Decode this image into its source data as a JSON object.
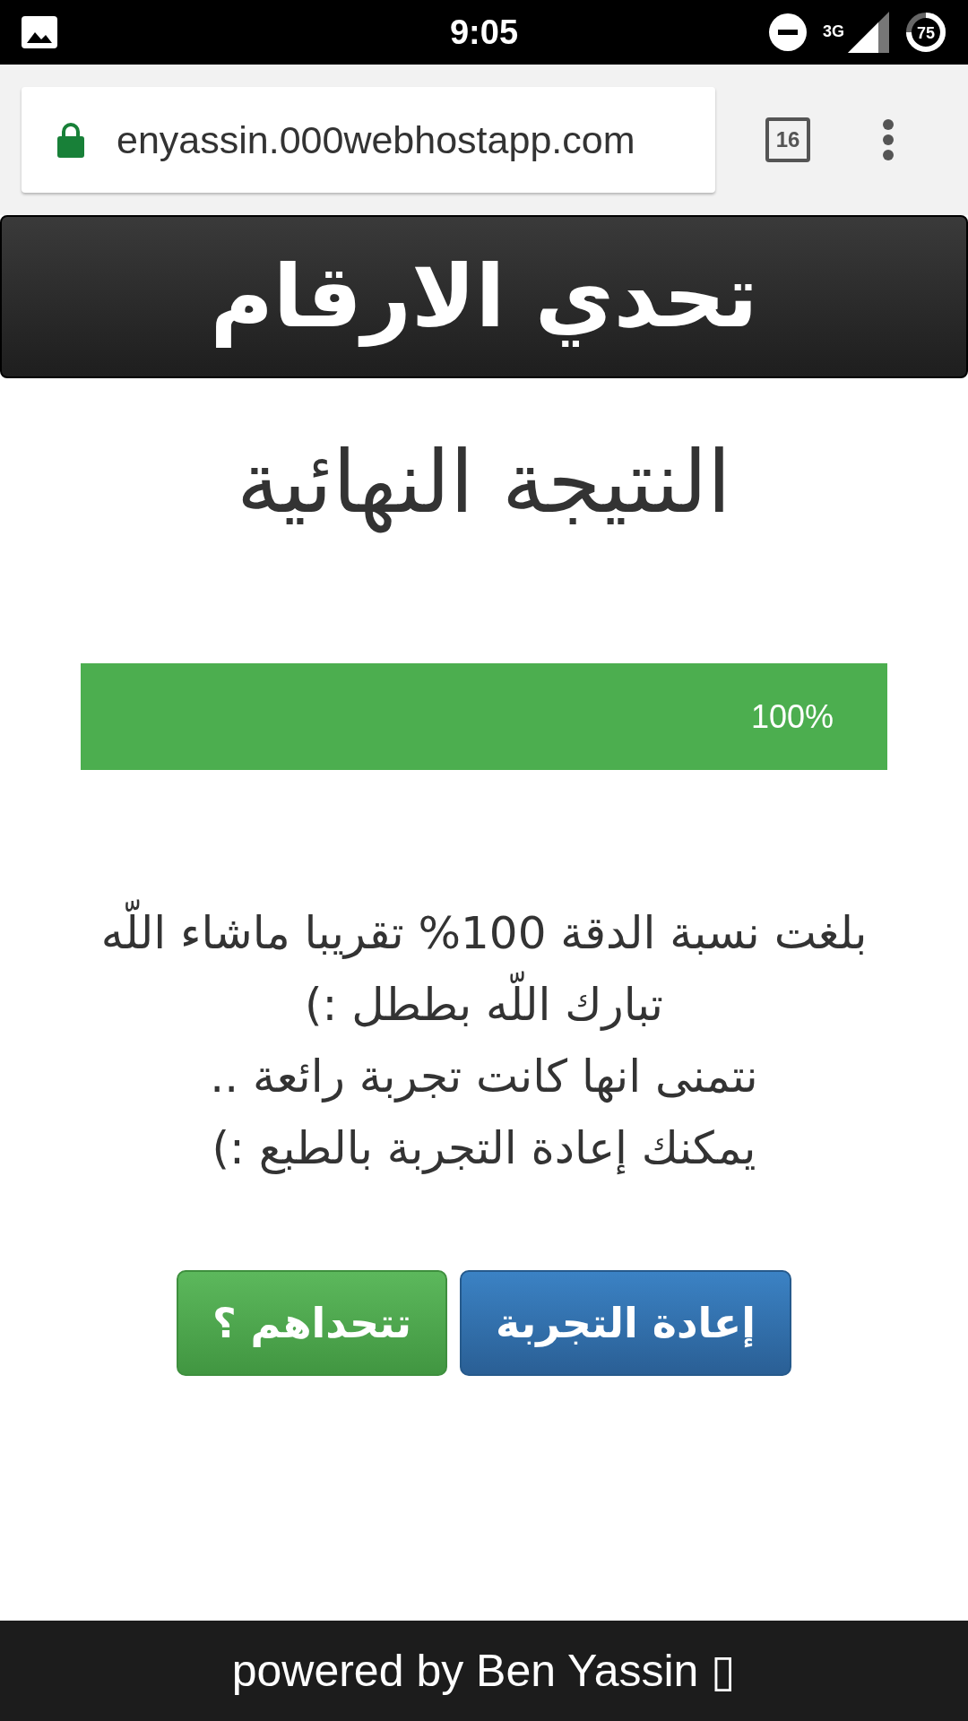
{
  "status_bar": {
    "time": "9:05",
    "network": "3G",
    "battery": "75"
  },
  "browser": {
    "url": "enyassin.000webhostapp.com",
    "tab_count": "16"
  },
  "header": {
    "title": "تحدي الارقام"
  },
  "result_title": "النتيجة النهائية",
  "progress": {
    "level": 1,
    "label": "100%"
  },
  "message": [
    "بلغت نسبة الدقة 100% تقريبا ماشاء اللّه تبارك اللّه بططل :)",
    "نتمنى انها كانت تجربة رائعة ..",
    "يمكنك إعادة التجربة بالطبع :)"
  ],
  "buttons": [
    {
      "label": "إعادة التجربة",
      "kind": "primary"
    },
    {
      "label": "تتحداهم ؟",
      "kind": "success"
    }
  ],
  "footer": "powered by Ben Yassin ▯"
}
